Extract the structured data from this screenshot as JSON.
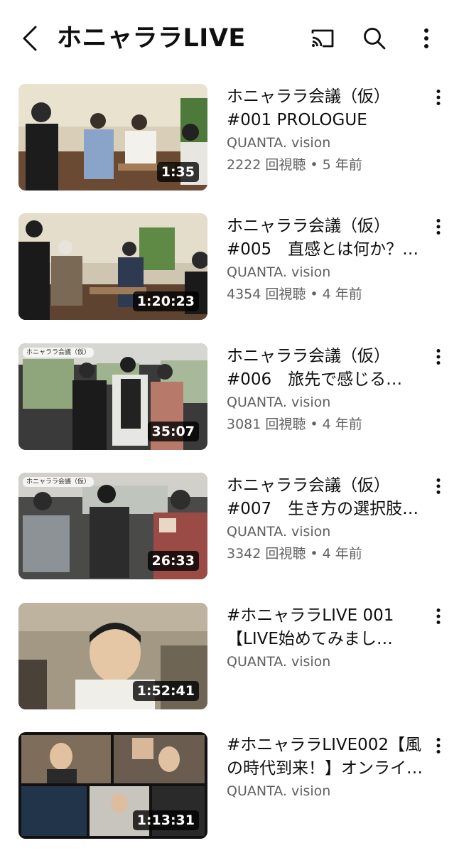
{
  "header": {
    "title": "ホニャララLIVE",
    "icons": [
      "back-arrow-icon",
      "cast-icon",
      "search-icon",
      "more-vert-icon"
    ]
  },
  "videos": [
    {
      "title": "ホニャララ会議（仮）\n#001 PROLOGUE",
      "channel": "QUANTA. vision",
      "meta": "2222 回視聴 • 5 年前",
      "duration": "1:35",
      "channel_tag": ""
    },
    {
      "title": "ホニャララ会議（仮）\n#005　直感とは何か？…",
      "channel": "QUANTA. vision",
      "meta": "4354 回視聴 • 4 年前",
      "duration": "1:20:23",
      "channel_tag": ""
    },
    {
      "title": "ホニャララ会議（仮）\n#006　旅先で感じる…",
      "channel": "QUANTA. vision",
      "meta": "3081 回視聴 • 4 年前",
      "duration": "35:07",
      "channel_tag": "ホニャララ会議（仮）"
    },
    {
      "title": "ホニャララ会議（仮）\n#007　生き方の選択肢…",
      "channel": "QUANTA. vision",
      "meta": "3342 回視聴 • 4 年前",
      "duration": "26:33",
      "channel_tag": "ホニャララ会議（仮）"
    },
    {
      "title": "#ホニャララLIVE 001\n【LIVE始めてみまし…",
      "channel": "QUANTA. vision",
      "meta": "",
      "duration": "1:52:41",
      "channel_tag": ""
    },
    {
      "title": "#ホニャララLIVE002【風\nの時代到来！】オンライ…",
      "channel": "QUANTA. vision",
      "meta": "",
      "duration": "1:13:31",
      "channel_tag": ""
    }
  ],
  "colors": {
    "text_primary": "#0f0f0f",
    "text_secondary": "#606060",
    "duration_bg": "#000000",
    "background": "#ffffff"
  }
}
